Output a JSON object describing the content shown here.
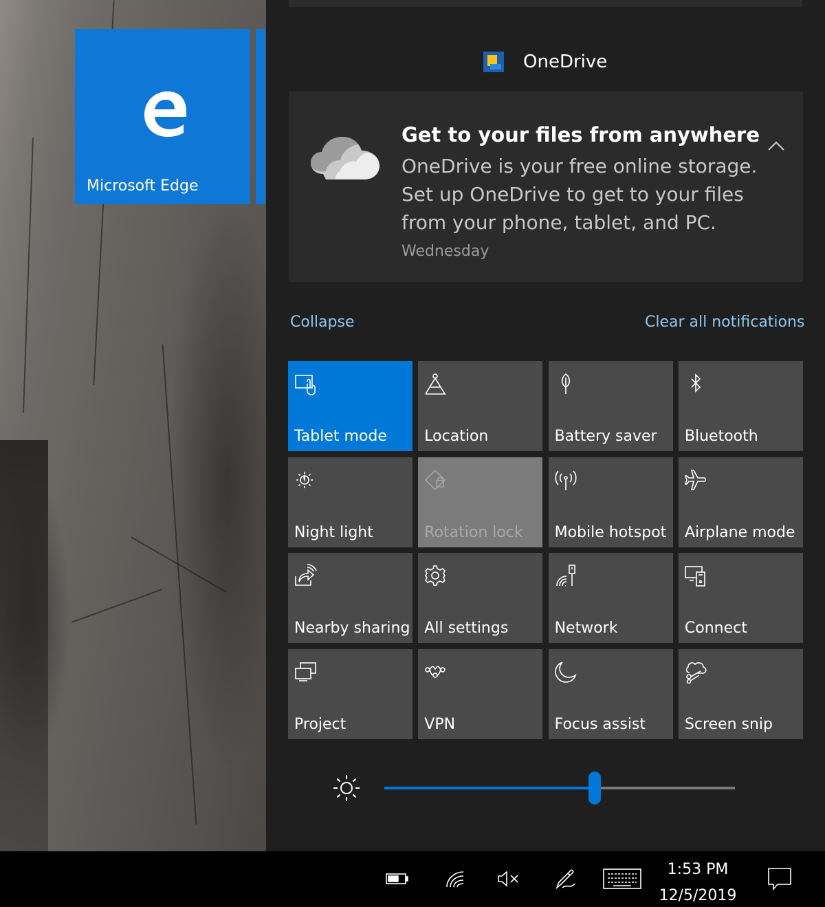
{
  "start_tile": {
    "label": "Microsoft Edge",
    "icon": "edge-icon",
    "color": "#0f78d7"
  },
  "notification_group": {
    "app_name": "OneDrive",
    "icon": "onedrive-icon"
  },
  "notification": {
    "title": "Get to your files from anywhere",
    "body": "OneDrive is your free online storage. Set up OneDrive to get to your files from your phone, tablet, and PC.",
    "time": "Wednesday",
    "icon": "cloud-icon",
    "expand_icon": "chevron-up-icon"
  },
  "links": {
    "collapse": "Collapse",
    "clear_all": "Clear all notifications"
  },
  "quick_actions": [
    {
      "label": "Tablet mode",
      "icon": "tablet-mode-icon",
      "state": "on"
    },
    {
      "label": "Location",
      "icon": "location-icon",
      "state": "off"
    },
    {
      "label": "Battery saver",
      "icon": "battery-saver-icon",
      "state": "off"
    },
    {
      "label": "Bluetooth",
      "icon": "bluetooth-icon",
      "state": "off"
    },
    {
      "label": "Night light",
      "icon": "night-light-icon",
      "state": "off"
    },
    {
      "label": "Rotation lock",
      "icon": "rotation-lock-icon",
      "state": "disabled"
    },
    {
      "label": "Mobile hotspot",
      "icon": "mobile-hotspot-icon",
      "state": "off"
    },
    {
      "label": "Airplane mode",
      "icon": "airplane-icon",
      "state": "off"
    },
    {
      "label": "Nearby sharing",
      "icon": "nearby-sharing-icon",
      "state": "off"
    },
    {
      "label": "All settings",
      "icon": "gear-icon",
      "state": "off"
    },
    {
      "label": "Network",
      "icon": "network-icon",
      "state": "off"
    },
    {
      "label": "Connect",
      "icon": "connect-icon",
      "state": "off"
    },
    {
      "label": "Project",
      "icon": "project-icon",
      "state": "off"
    },
    {
      "label": "VPN",
      "icon": "vpn-icon",
      "state": "off"
    },
    {
      "label": "Focus assist",
      "icon": "moon-icon",
      "state": "off"
    },
    {
      "label": "Screen snip",
      "icon": "screen-snip-icon",
      "state": "off"
    }
  ],
  "brightness": {
    "icon": "brightness-icon",
    "level_fraction": 0.6
  },
  "taskbar": {
    "tray_icons": [
      "battery-icon",
      "wifi-icon",
      "volume-muted-icon",
      "pen-icon",
      "keyboard-icon"
    ],
    "time": "1:53 PM",
    "date": "12/5/2019",
    "action_center_icon": "action-center-icon"
  },
  "colors": {
    "accent": "#0078d7",
    "link": "#8cc6f2",
    "tile_off": "#4a4a4a",
    "panel": "#1f1f1f"
  }
}
